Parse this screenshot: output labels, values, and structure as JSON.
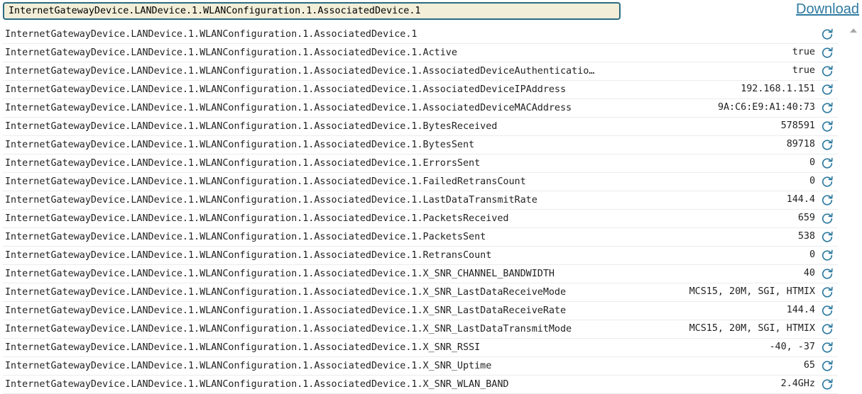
{
  "filter": {
    "value": "InternetGatewayDevice.LANDevice.1.WLANConfiguration.1.AssociatedDevice.1"
  },
  "toolbar": {
    "download_label": "Download"
  },
  "colors": {
    "accent": "#2e7aa0",
    "filter_bg": "#f2eed8",
    "filter_border": "#2a6b80"
  },
  "rows": [
    {
      "name": "InternetGatewayDevice.LANDevice.1.WLANConfiguration.1.AssociatedDevice.1",
      "value": ""
    },
    {
      "name": "InternetGatewayDevice.LANDevice.1.WLANConfiguration.1.AssociatedDevice.1.Active",
      "value": "true"
    },
    {
      "name": "InternetGatewayDevice.LANDevice.1.WLANConfiguration.1.AssociatedDevice.1.AssociatedDeviceAuthenticatio…",
      "value": "true"
    },
    {
      "name": "InternetGatewayDevice.LANDevice.1.WLANConfiguration.1.AssociatedDevice.1.AssociatedDeviceIPAddress",
      "value": "192.168.1.151"
    },
    {
      "name": "InternetGatewayDevice.LANDevice.1.WLANConfiguration.1.AssociatedDevice.1.AssociatedDeviceMACAddress",
      "value": "9A:C6:E9:A1:40:73"
    },
    {
      "name": "InternetGatewayDevice.LANDevice.1.WLANConfiguration.1.AssociatedDevice.1.BytesReceived",
      "value": "578591"
    },
    {
      "name": "InternetGatewayDevice.LANDevice.1.WLANConfiguration.1.AssociatedDevice.1.BytesSent",
      "value": "89718"
    },
    {
      "name": "InternetGatewayDevice.LANDevice.1.WLANConfiguration.1.AssociatedDevice.1.ErrorsSent",
      "value": "0"
    },
    {
      "name": "InternetGatewayDevice.LANDevice.1.WLANConfiguration.1.AssociatedDevice.1.FailedRetransCount",
      "value": "0"
    },
    {
      "name": "InternetGatewayDevice.LANDevice.1.WLANConfiguration.1.AssociatedDevice.1.LastDataTransmitRate",
      "value": "144.4"
    },
    {
      "name": "InternetGatewayDevice.LANDevice.1.WLANConfiguration.1.AssociatedDevice.1.PacketsReceived",
      "value": "659"
    },
    {
      "name": "InternetGatewayDevice.LANDevice.1.WLANConfiguration.1.AssociatedDevice.1.PacketsSent",
      "value": "538"
    },
    {
      "name": "InternetGatewayDevice.LANDevice.1.WLANConfiguration.1.AssociatedDevice.1.RetransCount",
      "value": "0"
    },
    {
      "name": "InternetGatewayDevice.LANDevice.1.WLANConfiguration.1.AssociatedDevice.1.X_SNR_CHANNEL_BANDWIDTH",
      "value": "40"
    },
    {
      "name": "InternetGatewayDevice.LANDevice.1.WLANConfiguration.1.AssociatedDevice.1.X_SNR_LastDataReceiveMode",
      "value": "MCS15, 20M, SGI, HTMIX"
    },
    {
      "name": "InternetGatewayDevice.LANDevice.1.WLANConfiguration.1.AssociatedDevice.1.X_SNR_LastDataReceiveRate",
      "value": "144.4"
    },
    {
      "name": "InternetGatewayDevice.LANDevice.1.WLANConfiguration.1.AssociatedDevice.1.X_SNR_LastDataTransmitMode",
      "value": "MCS15, 20M, SGI, HTMIX"
    },
    {
      "name": "InternetGatewayDevice.LANDevice.1.WLANConfiguration.1.AssociatedDevice.1.X_SNR_RSSI",
      "value": "-40, -37"
    },
    {
      "name": "InternetGatewayDevice.LANDevice.1.WLANConfiguration.1.AssociatedDevice.1.X_SNR_Uptime",
      "value": "65"
    },
    {
      "name": "InternetGatewayDevice.LANDevice.1.WLANConfiguration.1.AssociatedDevice.1.X_SNR_WLAN_BAND",
      "value": "2.4GHz"
    }
  ],
  "icons": {
    "row_action": "refresh-icon",
    "scroll": "scroll-up-arrow-icon"
  }
}
